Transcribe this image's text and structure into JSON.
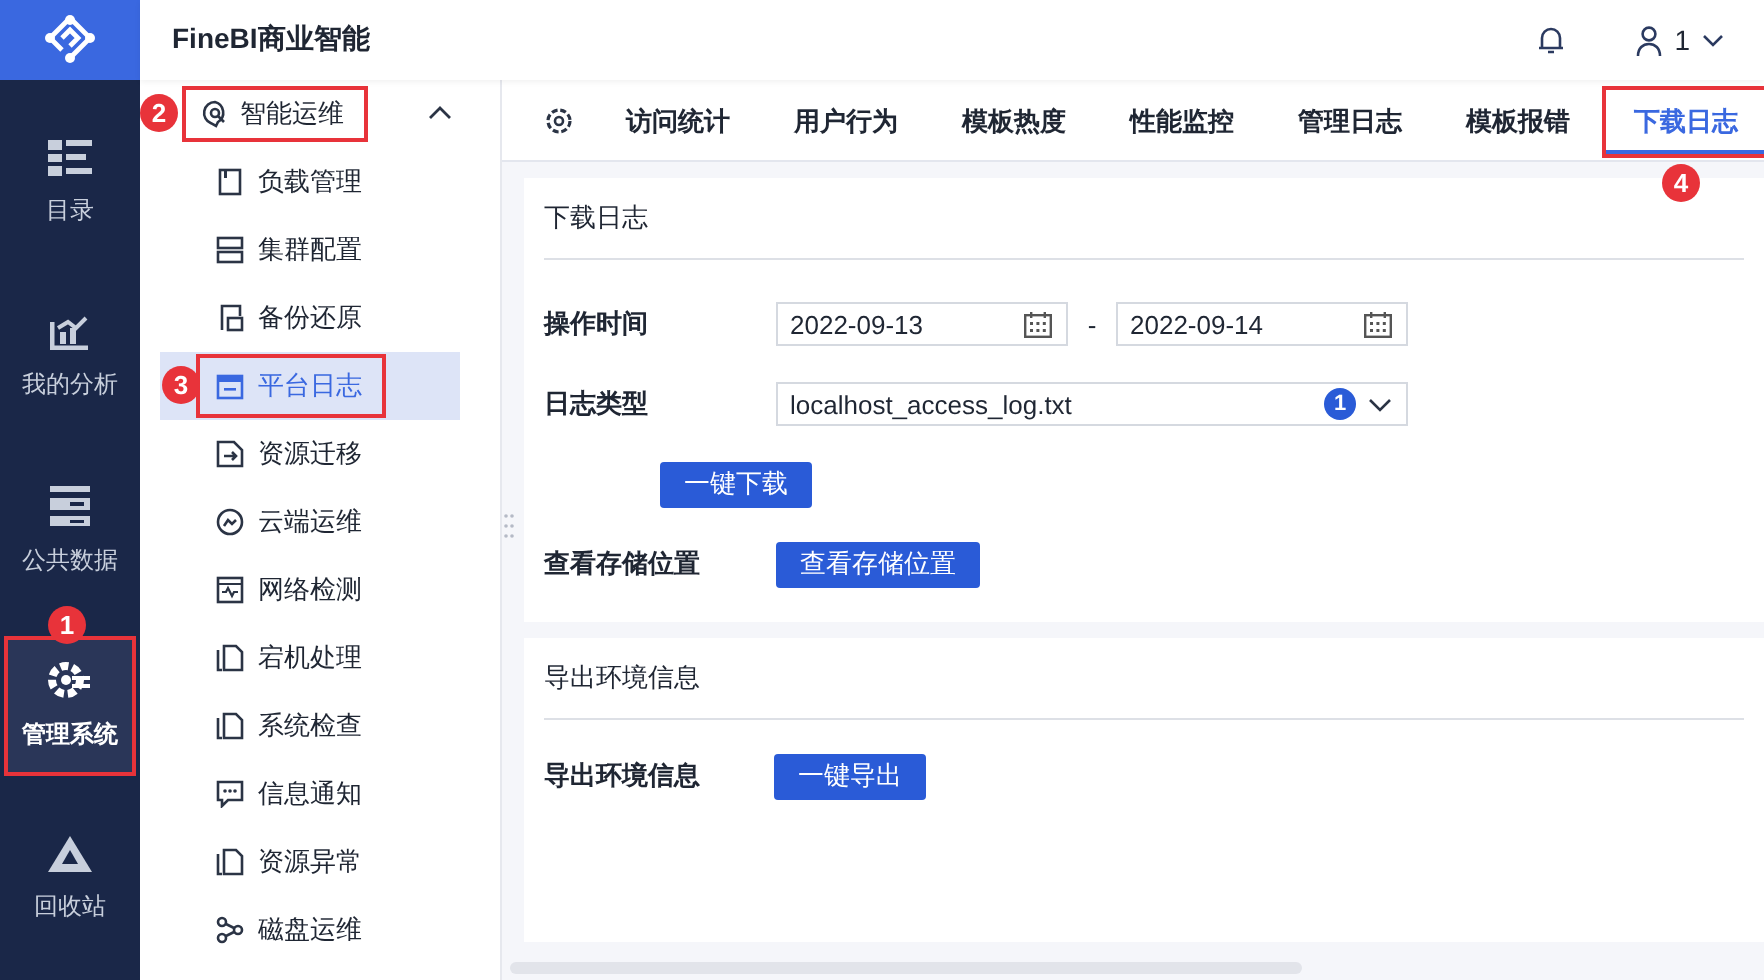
{
  "app": {
    "title": "FineBI商业智能",
    "user": "1"
  },
  "rail": [
    {
      "label": "目录",
      "selected": false
    },
    {
      "label": "我的分析",
      "selected": false
    },
    {
      "label": "公共数据",
      "selected": false
    },
    {
      "label": "管理系统",
      "selected": true,
      "callout": "1"
    },
    {
      "label": "回收站",
      "selected": false
    }
  ],
  "menu": {
    "group": {
      "label": "智能运维",
      "expanded": true,
      "callout": "2"
    },
    "items": [
      {
        "label": "负载管理",
        "selected": false
      },
      {
        "label": "集群配置",
        "selected": false
      },
      {
        "label": "备份还原",
        "selected": false
      },
      {
        "label": "平台日志",
        "selected": true,
        "callout": "3"
      },
      {
        "label": "资源迁移",
        "selected": false
      },
      {
        "label": "云端运维",
        "selected": false
      },
      {
        "label": "网络检测",
        "selected": false
      },
      {
        "label": "宕机处理",
        "selected": false
      },
      {
        "label": "系统检查",
        "selected": false
      },
      {
        "label": "信息通知",
        "selected": false
      },
      {
        "label": "资源异常",
        "selected": false
      },
      {
        "label": "磁盘运维",
        "selected": false
      }
    ]
  },
  "tabs": [
    {
      "label": "访问统计",
      "selected": false
    },
    {
      "label": "用户行为",
      "selected": false
    },
    {
      "label": "模板热度",
      "selected": false
    },
    {
      "label": "性能监控",
      "selected": false
    },
    {
      "label": "管理日志",
      "selected": false
    },
    {
      "label": "模板报错",
      "selected": false
    },
    {
      "label": "下载日志",
      "selected": true,
      "callout": "4"
    }
  ],
  "download_panel": {
    "title": "下载日志",
    "time_label": "操作时间",
    "start": "2022-09-13",
    "separator": "-",
    "end": "2022-09-14",
    "type_label": "日志类型",
    "type_value": "localhost_access_log.txt",
    "type_badge": "1",
    "download_button": "一键下载",
    "location_label": "查看存储位置",
    "location_button": "查看存储位置"
  },
  "export_panel": {
    "title": "导出环境信息",
    "label": "导出环境信息",
    "button": "一键导出"
  }
}
